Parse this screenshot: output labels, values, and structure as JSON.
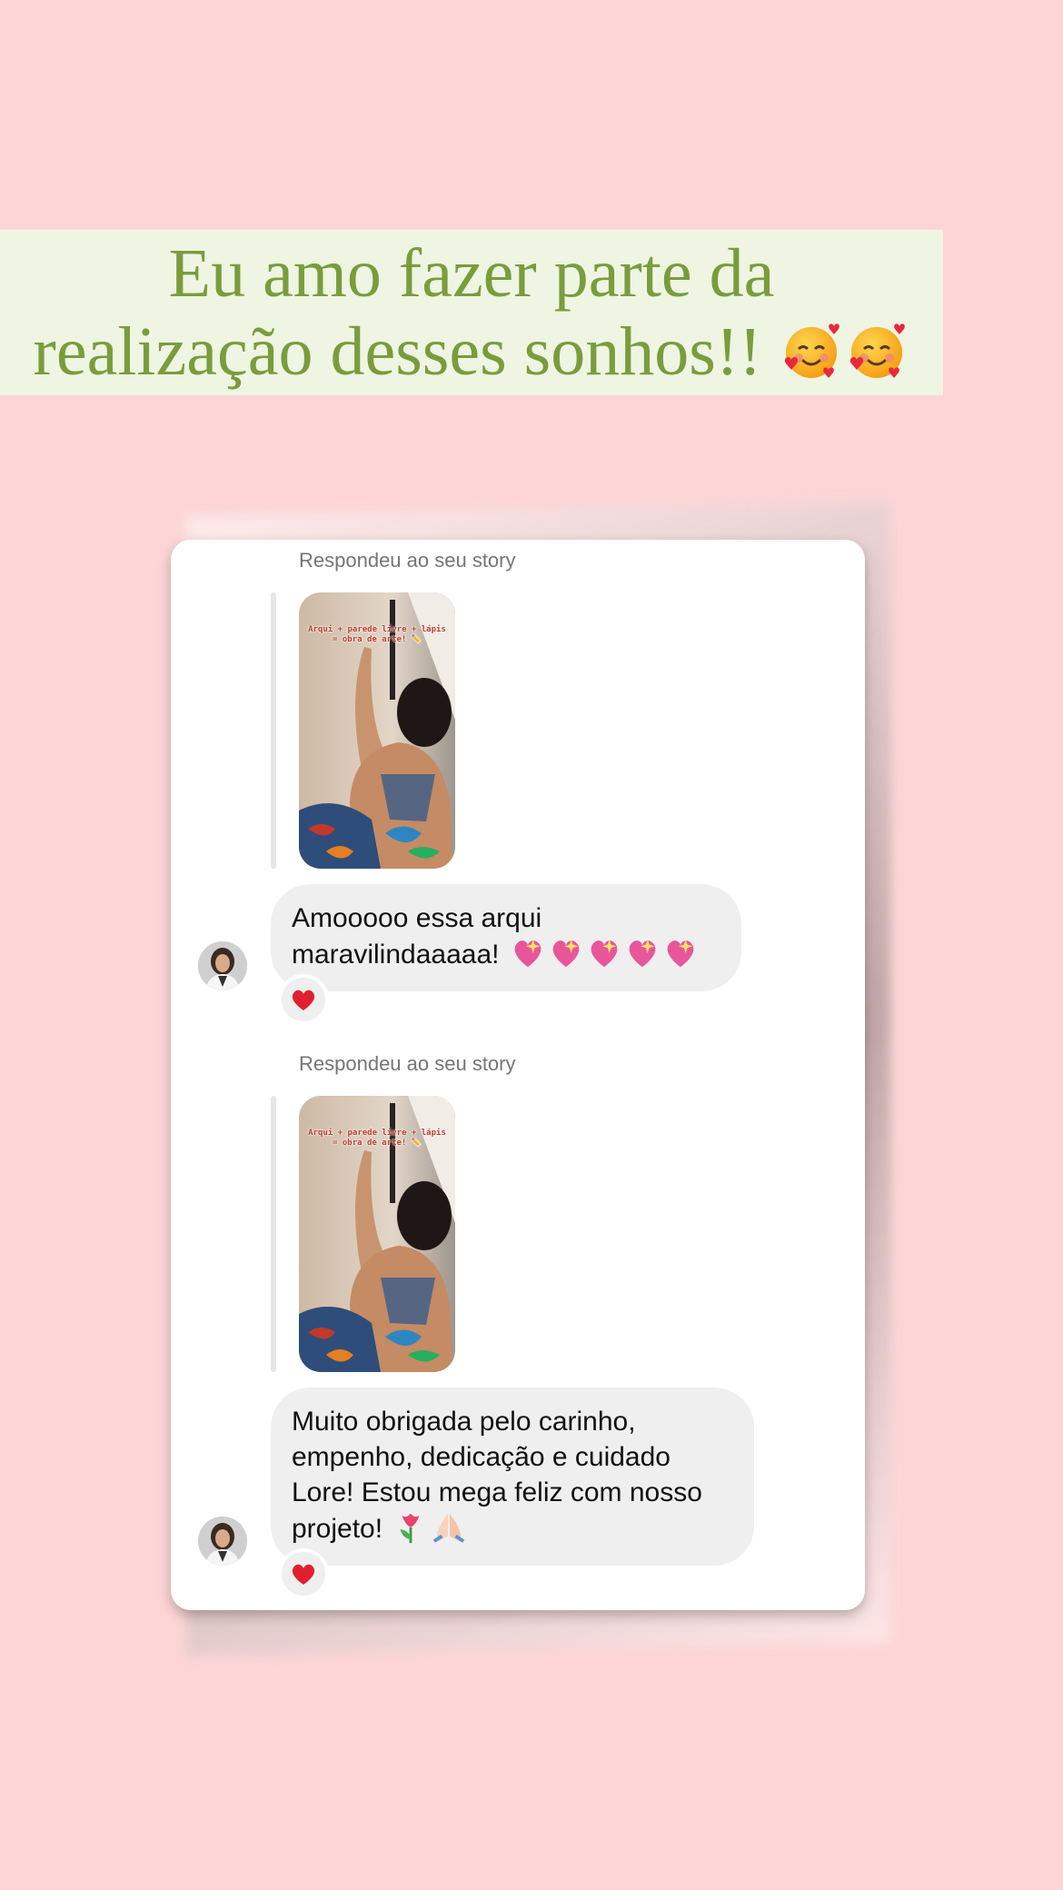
{
  "banner": {
    "line1": "Eu amo fazer parte da",
    "line2": "realização desses sonhos!!",
    "emoji": "smiling-face-with-hearts-icon",
    "text_color": "#7a9c3c",
    "background": "#eef5e3"
  },
  "page": {
    "background": "#fdd5d6"
  },
  "chat": {
    "messages": [
      {
        "reply_label": "Respondeu ao seu story",
        "story_caption": "Arqui + parede livre + lápis = obra de arte! ✏️",
        "bubble_line1": "Amooooo essa arqui",
        "bubble_line2": "maravilindaaaaa!",
        "bubble_emojis": [
          "sparkling-heart-icon",
          "sparkling-heart-icon",
          "sparkling-heart-icon",
          "sparkling-heart-icon",
          "sparkling-heart-icon"
        ],
        "reaction": "red-heart-icon"
      },
      {
        "reply_label": "Respondeu ao seu story",
        "story_caption": "Arqui + parede livre + lápis = obra de arte! ✏️",
        "bubble_line1": "Muito obrigada pelo carinho,",
        "bubble_line2": "empenho, dedicação e cuidado",
        "bubble_line3": "Lore! Estou mega feliz com nosso",
        "bubble_line4": "projeto!",
        "bubble_emojis": [
          "tulip-icon",
          "folded-hands-icon"
        ],
        "reaction": "red-heart-icon"
      }
    ]
  }
}
